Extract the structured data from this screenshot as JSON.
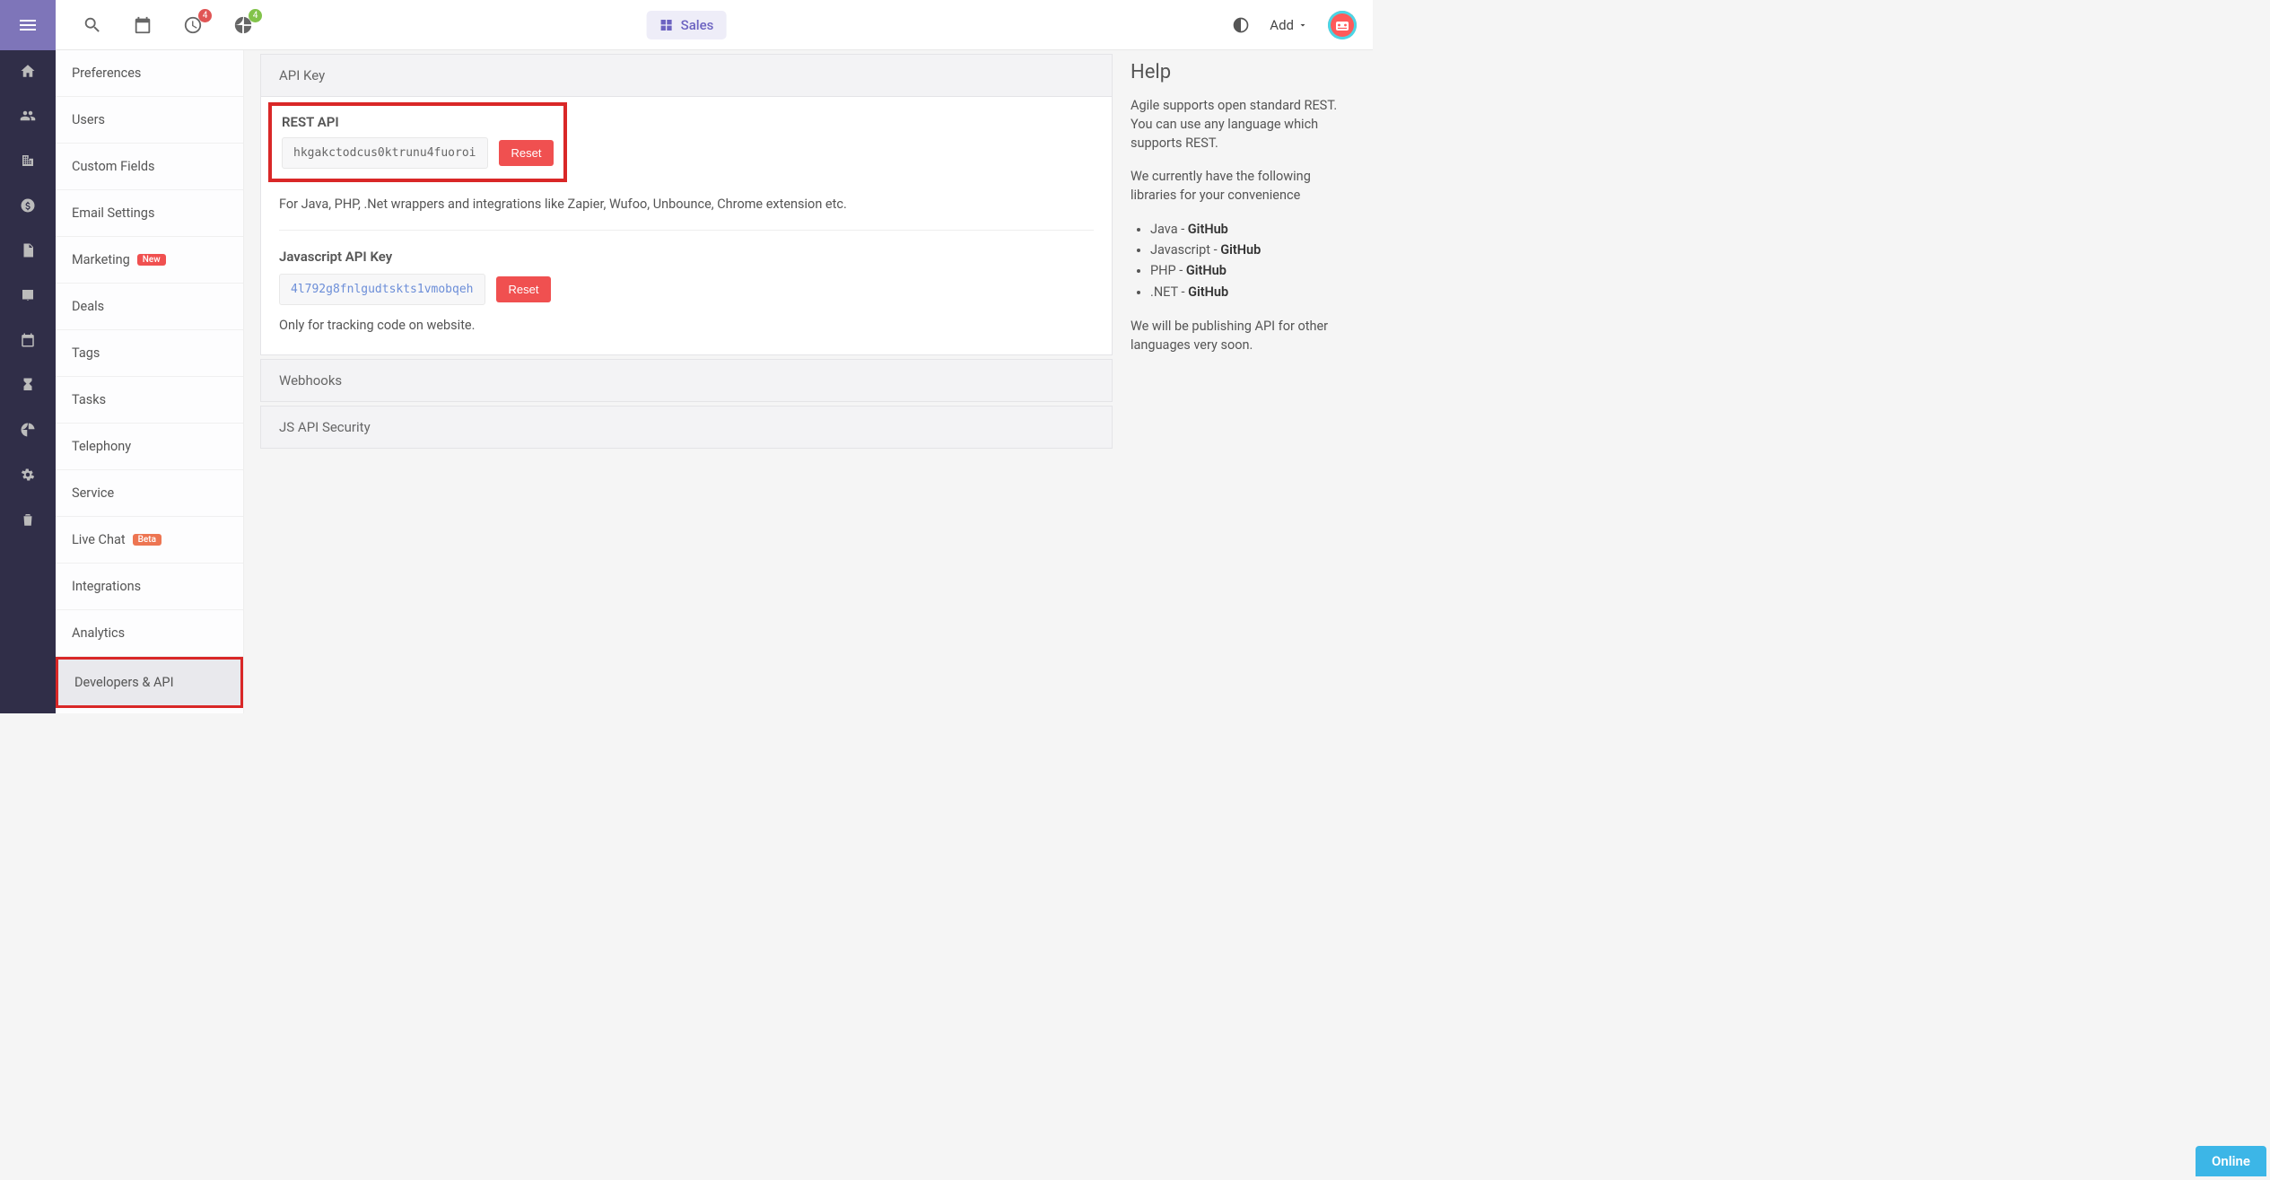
{
  "topbar": {
    "timer_badge": "4",
    "chart_badge": "4",
    "sales_label": "Sales",
    "add_label": "Add"
  },
  "settings_nav": {
    "items": [
      {
        "label": "Preferences"
      },
      {
        "label": "Users"
      },
      {
        "label": "Custom Fields"
      },
      {
        "label": "Email Settings"
      },
      {
        "label": "Marketing",
        "pill": "New",
        "pill_class": "red"
      },
      {
        "label": "Deals"
      },
      {
        "label": "Tags"
      },
      {
        "label": "Tasks"
      },
      {
        "label": "Telephony"
      },
      {
        "label": "Service"
      },
      {
        "label": "Live Chat",
        "pill": "Beta",
        "pill_class": "orange"
      },
      {
        "label": "Integrations"
      },
      {
        "label": "Analytics"
      },
      {
        "label": "Developers & API",
        "active": true,
        "highlight": true
      }
    ]
  },
  "accordion": {
    "section_api_key": "API Key",
    "rest_title": "REST API",
    "rest_value": "hkgakctodcus0ktrunu4fuoroi",
    "rest_reset": "Reset",
    "rest_note": "For Java, PHP, .Net wrappers and integrations like Zapier, Wufoo, Unbounce, Chrome extension etc.",
    "js_title": "Javascript API Key",
    "js_value": "4l792g8fnlgudtskts1vmobqeh",
    "js_reset": "Reset",
    "js_note": "Only for tracking code on website.",
    "section_webhooks": "Webhooks",
    "section_js_security": "JS API Security"
  },
  "help": {
    "title": "Help",
    "p1": "Agile supports open standard REST. You can use any language which supports REST.",
    "p2": "We currently have the following libraries for your convenience",
    "libs": [
      {
        "lang": "Java",
        "sep": " - ",
        "link_label": "GitHub"
      },
      {
        "lang": "Javascript",
        "sep": " - ",
        "link_label": "GitHub"
      },
      {
        "lang": "PHP",
        "sep": " - ",
        "link_label": "GitHub"
      },
      {
        "lang": ".NET",
        "sep": " - ",
        "link_label": "GitHub"
      }
    ],
    "p3": "We will be publishing API for other languages very soon."
  },
  "online": {
    "label": "Online"
  }
}
